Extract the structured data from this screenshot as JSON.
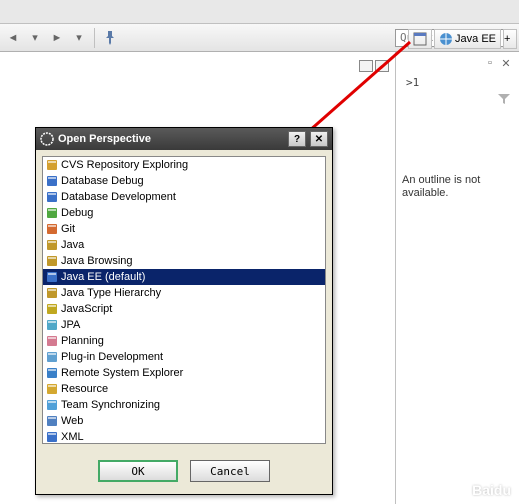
{
  "toolbar": {
    "quick_access_placeholder": "Quick Access",
    "perspective_label": "Java EE"
  },
  "outline": {
    "sub": ">1",
    "text_line1": "An outline is not",
    "text_line2": "available."
  },
  "dialog": {
    "title": "Open Perspective",
    "ok": "OK",
    "cancel": "Cancel"
  },
  "perspectives": [
    {
      "label": "CVS Repository Exploring",
      "icon": "#d4a030"
    },
    {
      "label": "Database Debug",
      "icon": "#3a70c8"
    },
    {
      "label": "Database Development",
      "icon": "#3a70c8"
    },
    {
      "label": "Debug",
      "icon": "#50a840"
    },
    {
      "label": "Git",
      "icon": "#d46a30"
    },
    {
      "label": "Java",
      "icon": "#c0982a"
    },
    {
      "label": "Java Browsing",
      "icon": "#c0982a"
    },
    {
      "label": "Java EE (default)",
      "icon": "#3a70c8",
      "selected": true
    },
    {
      "label": "Java Type Hierarchy",
      "icon": "#c0982a"
    },
    {
      "label": "JavaScript",
      "icon": "#c0a820"
    },
    {
      "label": "JPA",
      "icon": "#50a8c8"
    },
    {
      "label": "Planning",
      "icon": "#d47a90"
    },
    {
      "label": "Plug-in Development",
      "icon": "#60a0d0"
    },
    {
      "label": "Remote System Explorer",
      "icon": "#3a80c8"
    },
    {
      "label": "Resource",
      "icon": "#d4a830"
    },
    {
      "label": "Team Synchronizing",
      "icon": "#50a0d8"
    },
    {
      "label": "Web",
      "icon": "#5080c0"
    },
    {
      "label": "XML",
      "icon": "#3a70c8"
    }
  ],
  "watermark": "Baidu"
}
